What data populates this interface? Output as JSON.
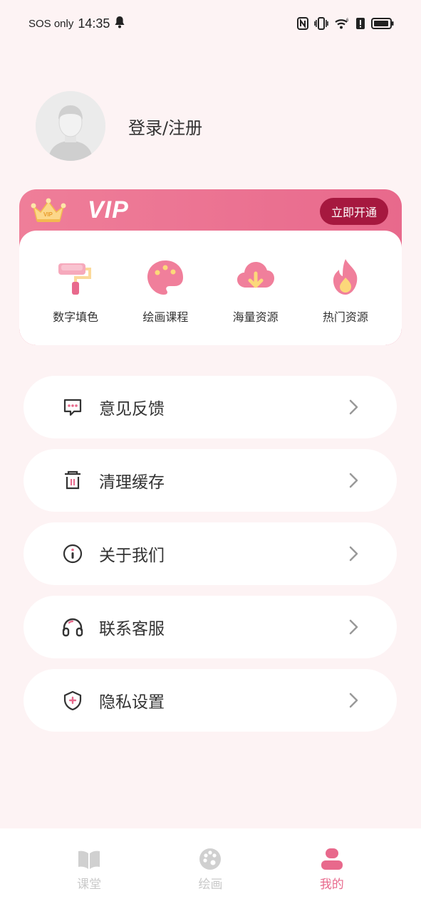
{
  "status_bar": {
    "carrier": "SOS only",
    "time": "14:35",
    "icons": [
      "bell-icon",
      "nfc-icon",
      "vibrate-icon",
      "wifi-icon",
      "alert-icon",
      "battery-icon"
    ]
  },
  "profile": {
    "login_label": "登录/注册"
  },
  "vip": {
    "title": "VIP",
    "open_button": "立即开通",
    "items": [
      {
        "label": "数字填色",
        "icon": "paint-roller-icon"
      },
      {
        "label": "绘画课程",
        "icon": "palette-icon"
      },
      {
        "label": "海量资源",
        "icon": "cloud-download-icon"
      },
      {
        "label": "热门资源",
        "icon": "flame-icon"
      }
    ],
    "accent": "#e8698c",
    "button_color": "#a6183f"
  },
  "menu": [
    {
      "label": "意见反馈",
      "icon": "feedback-icon"
    },
    {
      "label": "清理缓存",
      "icon": "trash-icon"
    },
    {
      "label": "关于我们",
      "icon": "info-icon"
    },
    {
      "label": "联系客服",
      "icon": "headset-icon"
    },
    {
      "label": "隐私设置",
      "icon": "shield-icon"
    }
  ],
  "bottom_nav": {
    "tabs": [
      {
        "label": "课堂",
        "icon": "book-icon",
        "active": false
      },
      {
        "label": "绘画",
        "icon": "palette-icon",
        "active": false
      },
      {
        "label": "我的",
        "icon": "user-icon",
        "active": true
      }
    ],
    "active_color": "#e8698c",
    "inactive_color": "#c9c9c9"
  }
}
